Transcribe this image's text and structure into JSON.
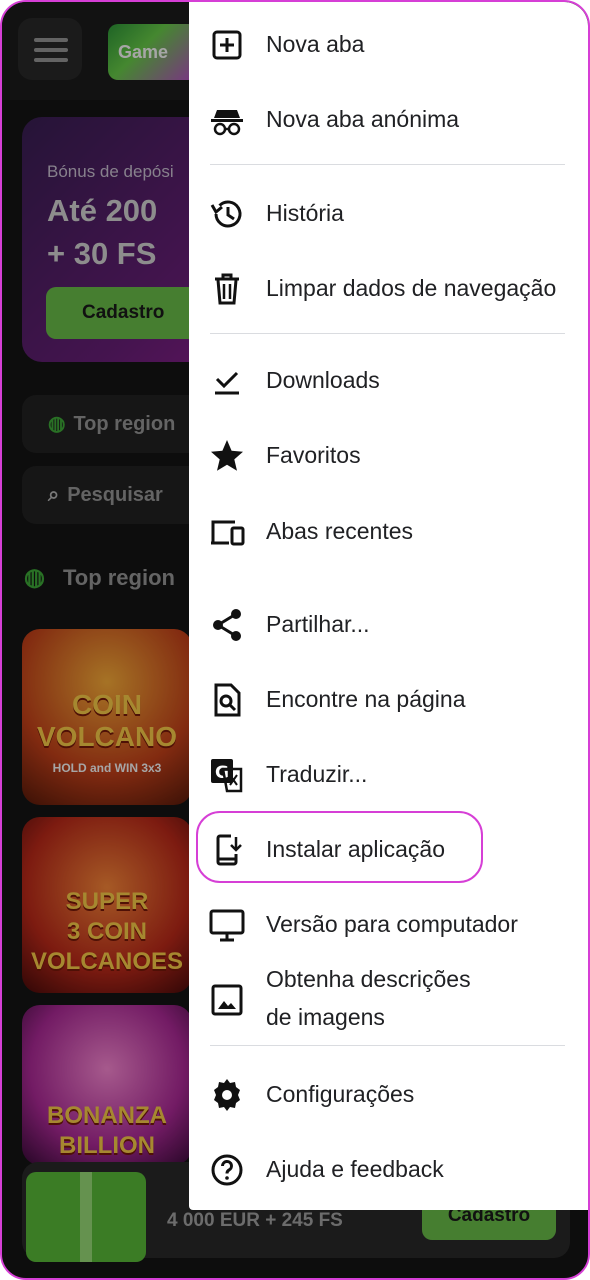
{
  "site": {
    "logo_text": "Game",
    "bonus_subtitle": "Bónus de depósi",
    "bonus_amount": "Até 200\n+ 30 FS",
    "register_button": "Cadastro",
    "region_chip": "Top region",
    "search_label": "Pesquisar",
    "section_title": "Top region",
    "games": [
      {
        "title": "COIN\nVOLCANO",
        "subtitle": "HOLD and WIN 3x3"
      },
      {
        "title": "SUPER\n3 COIN\nVOLCANOES",
        "subtitle": ""
      },
      {
        "title": "BONANZA\nBILLION",
        "subtitle": ""
      }
    ],
    "banner_text": "4 000 EUR + 245 FS",
    "banner_button": "Cadastro"
  },
  "menu": {
    "items": [
      {
        "label": "Nova aba",
        "icon": "new-tab-icon"
      },
      {
        "label": "Nova aba anónima",
        "icon": "incognito-icon"
      },
      {
        "label": "História",
        "icon": "history-icon"
      },
      {
        "label": "Limpar dados de navegação",
        "icon": "trash-icon"
      },
      {
        "label": "Downloads",
        "icon": "download-icon"
      },
      {
        "label": "Favoritos",
        "icon": "star-icon"
      },
      {
        "label": "Abas recentes",
        "icon": "devices-icon"
      },
      {
        "label": "Partilhar...",
        "icon": "share-icon"
      },
      {
        "label": "Encontre na página",
        "icon": "find-in-page-icon"
      },
      {
        "label": "Traduzir...",
        "icon": "translate-icon"
      },
      {
        "label": "Instalar aplicação",
        "icon": "install-app-icon"
      },
      {
        "label": "Versão para computador",
        "icon": "desktop-icon"
      },
      {
        "label": "Obtenha descrições\nde imagens",
        "icon": "image-icon"
      },
      {
        "label": "Configurações",
        "icon": "settings-icon"
      },
      {
        "label": "Ajuda e feedback",
        "icon": "help-icon"
      }
    ]
  },
  "colors": {
    "highlight": "#d63fd6",
    "accent_green": "#6cc24a"
  }
}
